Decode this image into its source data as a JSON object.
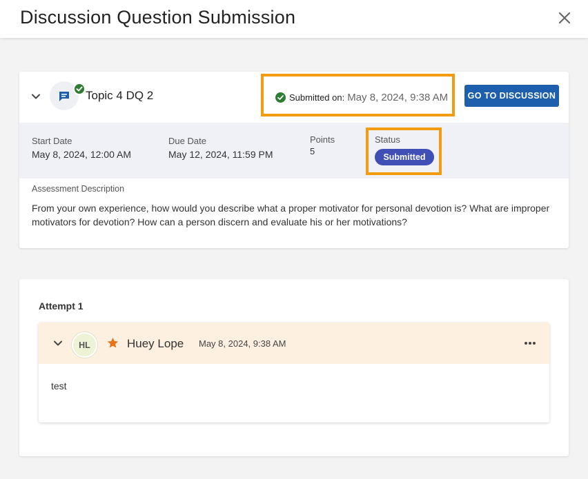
{
  "header": {
    "title": "Discussion Question Submission"
  },
  "topic": {
    "title": "Topic 4 DQ 2",
    "submitted_label": "Submitted on:",
    "submitted_value": "May 8, 2024, 9:38 AM",
    "go_button": "GO TO DISCUSSION"
  },
  "info": {
    "start_label": "Start Date",
    "start_value": "May 8, 2024, 12:00 AM",
    "due_label": "Due Date",
    "due_value": "May 12, 2024, 11:59 PM",
    "points_label": "Points",
    "points_value": "5",
    "status_label": "Status",
    "status_value": "Submitted"
  },
  "description": {
    "label": "Assessment Description",
    "text": "From your own experience, how would you describe what a proper motivator for personal devotion is? What are improper motivators for devotion? How can a person discern and evaluate his or her motivations?"
  },
  "attempt": {
    "label": "Attempt 1",
    "initials": "HL",
    "user_name": "Huey Lope",
    "date": "May 8, 2024, 9:38 AM",
    "body": "test"
  },
  "colors": {
    "highlight": "#f39c12",
    "primary_button": "#1d5fad",
    "status_pill": "#3f4fb5",
    "success": "#2e7d32",
    "star": "#e8711a"
  }
}
